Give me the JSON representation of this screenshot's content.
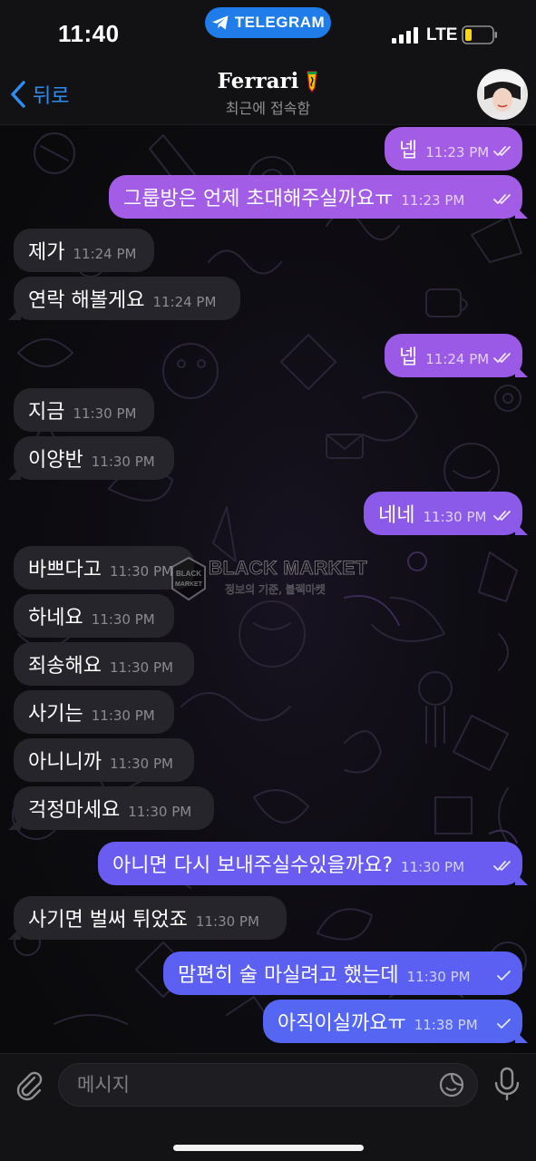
{
  "status_bar": {
    "time": "11:40",
    "app_pill": "TELEGRAM",
    "network": "LTE"
  },
  "header": {
    "back_label": "뒤로",
    "contact_name": "Ferrari",
    "contact_status": "최근에 접속함"
  },
  "watermark": {
    "title": "BLACK MARKET",
    "subtitle": "정보의 기준, 블랙마켓"
  },
  "messages": [
    {
      "dir": "out",
      "text": "넵",
      "time": "11:23 PM",
      "status": "read",
      "color": "#a35ce6"
    },
    {
      "dir": "out",
      "text": "그룹방은 언제 초대해주실까요ㅠ",
      "time": "11:23 PM",
      "status": "read",
      "color": "#a35ce6"
    },
    {
      "dir": "in",
      "text": "제가",
      "time": "11:24 PM"
    },
    {
      "dir": "in",
      "text": "연락 해볼게요",
      "time": "11:24 PM"
    },
    {
      "dir": "out",
      "text": "넵",
      "time": "11:24 PM",
      "status": "read",
      "color": "#9a5ae6"
    },
    {
      "dir": "in",
      "text": "지금",
      "time": "11:30 PM"
    },
    {
      "dir": "in",
      "text": "이양반",
      "time": "11:30 PM"
    },
    {
      "dir": "out",
      "text": "네네",
      "time": "11:30 PM",
      "status": "read",
      "color": "#8c5ae8"
    },
    {
      "dir": "in",
      "text": "바쁘다고",
      "time": "11:30 PM"
    },
    {
      "dir": "in",
      "text": "하네요",
      "time": "11:30 PM"
    },
    {
      "dir": "in",
      "text": "죄송해요",
      "time": "11:30 PM"
    },
    {
      "dir": "in",
      "text": "사기는",
      "time": "11:30 PM"
    },
    {
      "dir": "in",
      "text": "아니니까",
      "time": "11:30 PM"
    },
    {
      "dir": "in",
      "text": "걱정마세요",
      "time": "11:30 PM"
    },
    {
      "dir": "out",
      "text": "아니면 다시 보내주실수있을까요?",
      "time": "11:30 PM",
      "status": "read",
      "color": "#6a5cf0"
    },
    {
      "dir": "in",
      "text": "사기면 벌써 튀었죠",
      "time": "11:30 PM"
    },
    {
      "dir": "out",
      "text": "맘편히 술 마실려고 했는데",
      "time": "11:30 PM",
      "status": "sent",
      "color": "#5b5ff2"
    },
    {
      "dir": "out",
      "text": "아직이실까요ㅠ",
      "time": "11:38 PM",
      "status": "sent",
      "color": "#5566f2"
    }
  ],
  "composer": {
    "placeholder": "메시지"
  },
  "icons": {
    "back": "chevron-left-icon",
    "pill": "telegram-plane-icon",
    "attach": "paperclip-icon",
    "sticker": "sticker-icon",
    "mic": "microphone-icon",
    "read": "double-check-icon",
    "sent": "single-check-icon"
  },
  "colors": {
    "accent_blue": "#2d8cf0",
    "incoming_bubble": "#26252b",
    "outgoing_top": "#a35ce6",
    "outgoing_bottom": "#5566f2"
  }
}
